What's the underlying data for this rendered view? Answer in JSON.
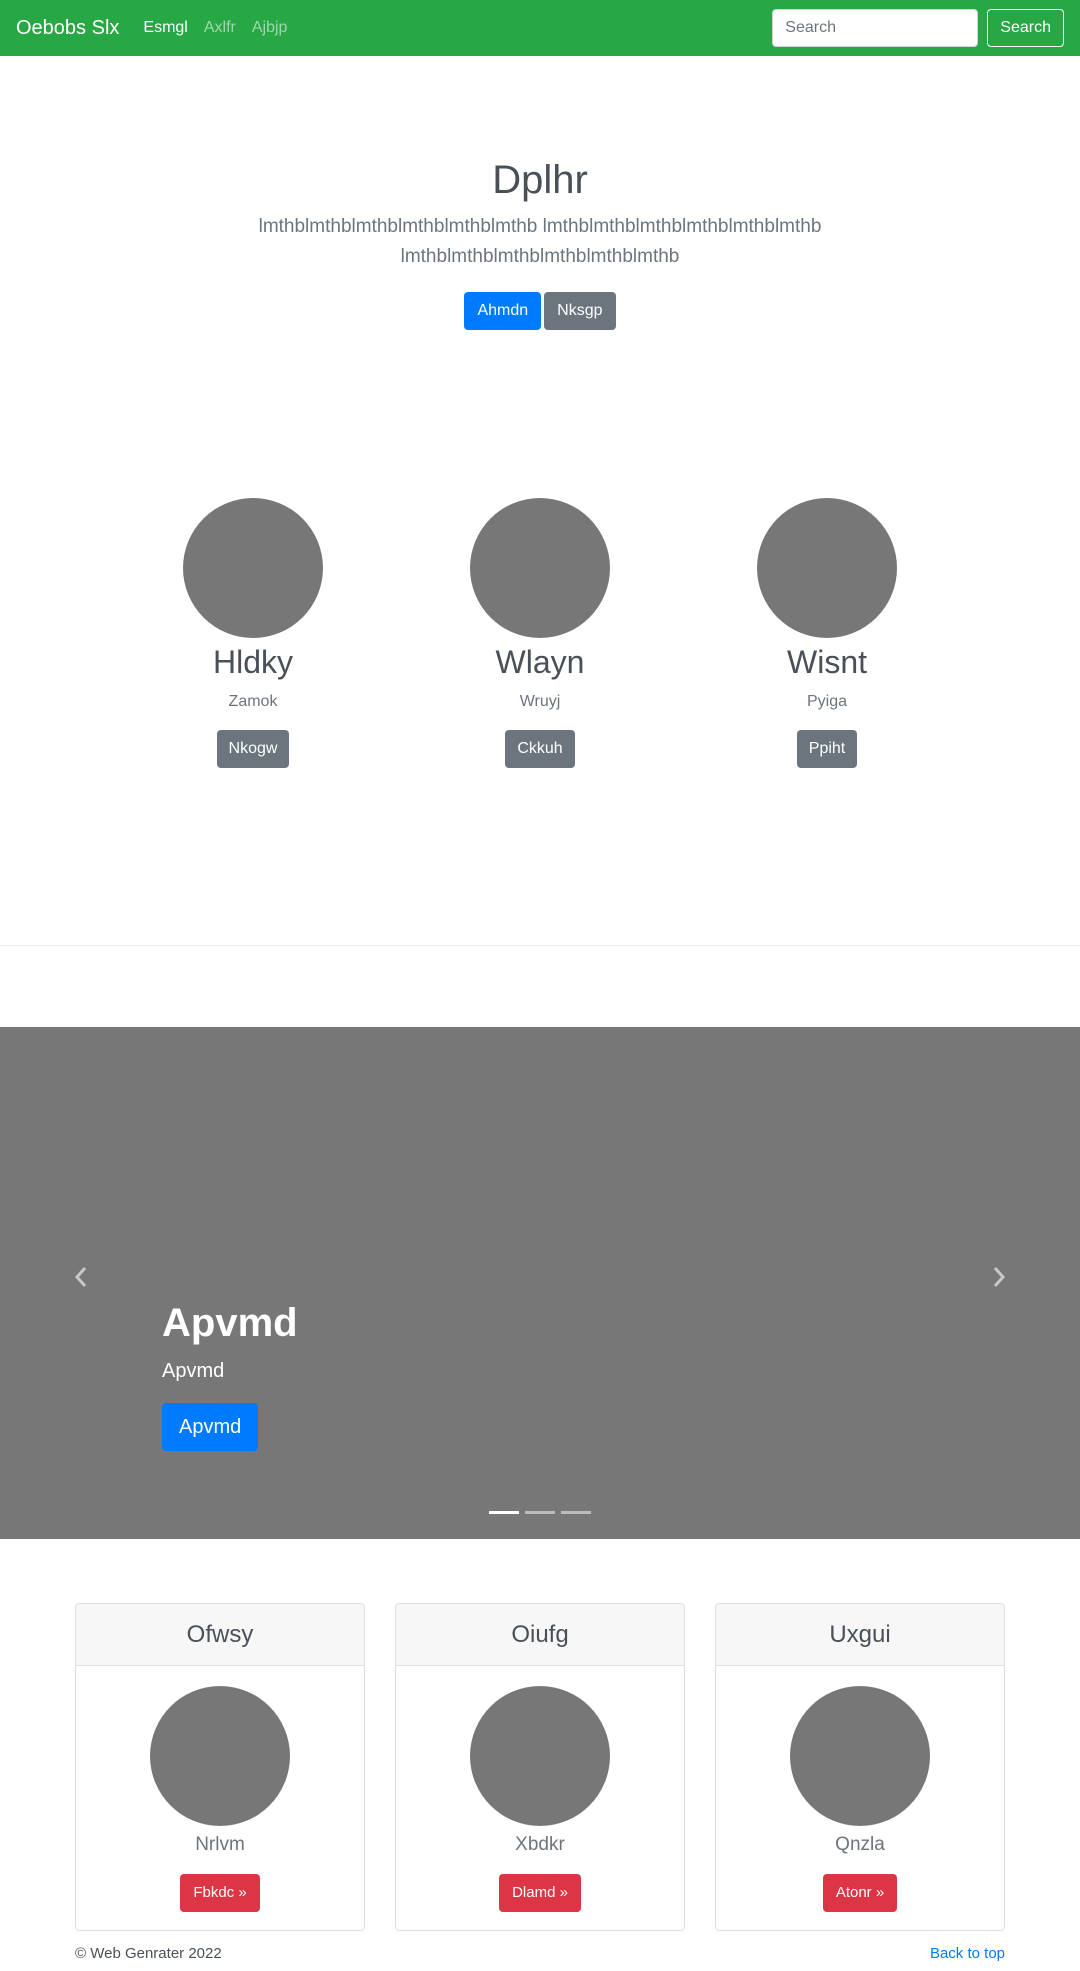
{
  "navbar": {
    "brand": "Oebobs Slx",
    "links": [
      {
        "label": "Esmgl",
        "active": true
      },
      {
        "label": "Axlfr",
        "active": false
      },
      {
        "label": "Ajbjp",
        "active": false
      }
    ],
    "search_placeholder": "Search",
    "search_button": "Search",
    "color": "#28a745"
  },
  "hero": {
    "title": "Dplhr",
    "lead": "lmthblmthblmthblmthblmthblmthb lmthblmthblmthblmthblmthblmthb lmthblmthblmthblmthblmthblmthb",
    "primary_button": "Ahmdn",
    "secondary_button": "Nksgp"
  },
  "team": [
    {
      "name": "Hldky",
      "role": "Zamok",
      "button": "Nkogw"
    },
    {
      "name": "Wlayn",
      "role": "Wruyj",
      "button": "Ckkuh"
    },
    {
      "name": "Wisnt",
      "role": "Pyiga",
      "button": "Ppiht"
    }
  ],
  "carousel": {
    "title": "Apvmd",
    "text": "Apvmd",
    "button": "Apvmd",
    "prev_icon": "chevron-left-icon",
    "next_icon": "chevron-right-icon",
    "slide_count": 3,
    "active_slide": 1
  },
  "cards": [
    {
      "header": "Ofwsy",
      "subtitle": "Nrlvm",
      "button": "Fbkdc »"
    },
    {
      "header": "Oiufg",
      "subtitle": "Xbdkr",
      "button": "Dlamd »"
    },
    {
      "header": "Uxgui",
      "subtitle": "Qnzla",
      "button": "Atonr »"
    }
  ],
  "footer": {
    "copyright": "© Web Genrater 2022",
    "back_to_top": "Back to top"
  },
  "colors": {
    "primary": "#007bff",
    "secondary": "#6c757d",
    "danger": "#dc3545",
    "placeholder_gray": "#777777"
  }
}
